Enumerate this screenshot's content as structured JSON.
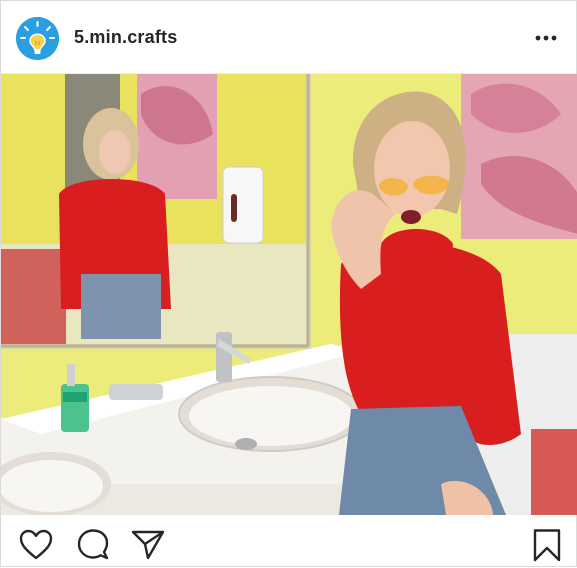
{
  "post": {
    "username": "5.min.crafts",
    "avatar_icon": "lightbulb-icon",
    "more_icon": "more-options-icon"
  },
  "media": {
    "description_icons": [
      "photo"
    ],
    "accent_colors": {
      "sweater": "#d81e1e",
      "wall_yellow": "#ecec7a",
      "tile_red": "#d85a55"
    }
  },
  "actions": {
    "like_icon": "heart-icon",
    "comment_icon": "comment-icon",
    "share_icon": "send-icon",
    "save_icon": "bookmark-icon"
  }
}
